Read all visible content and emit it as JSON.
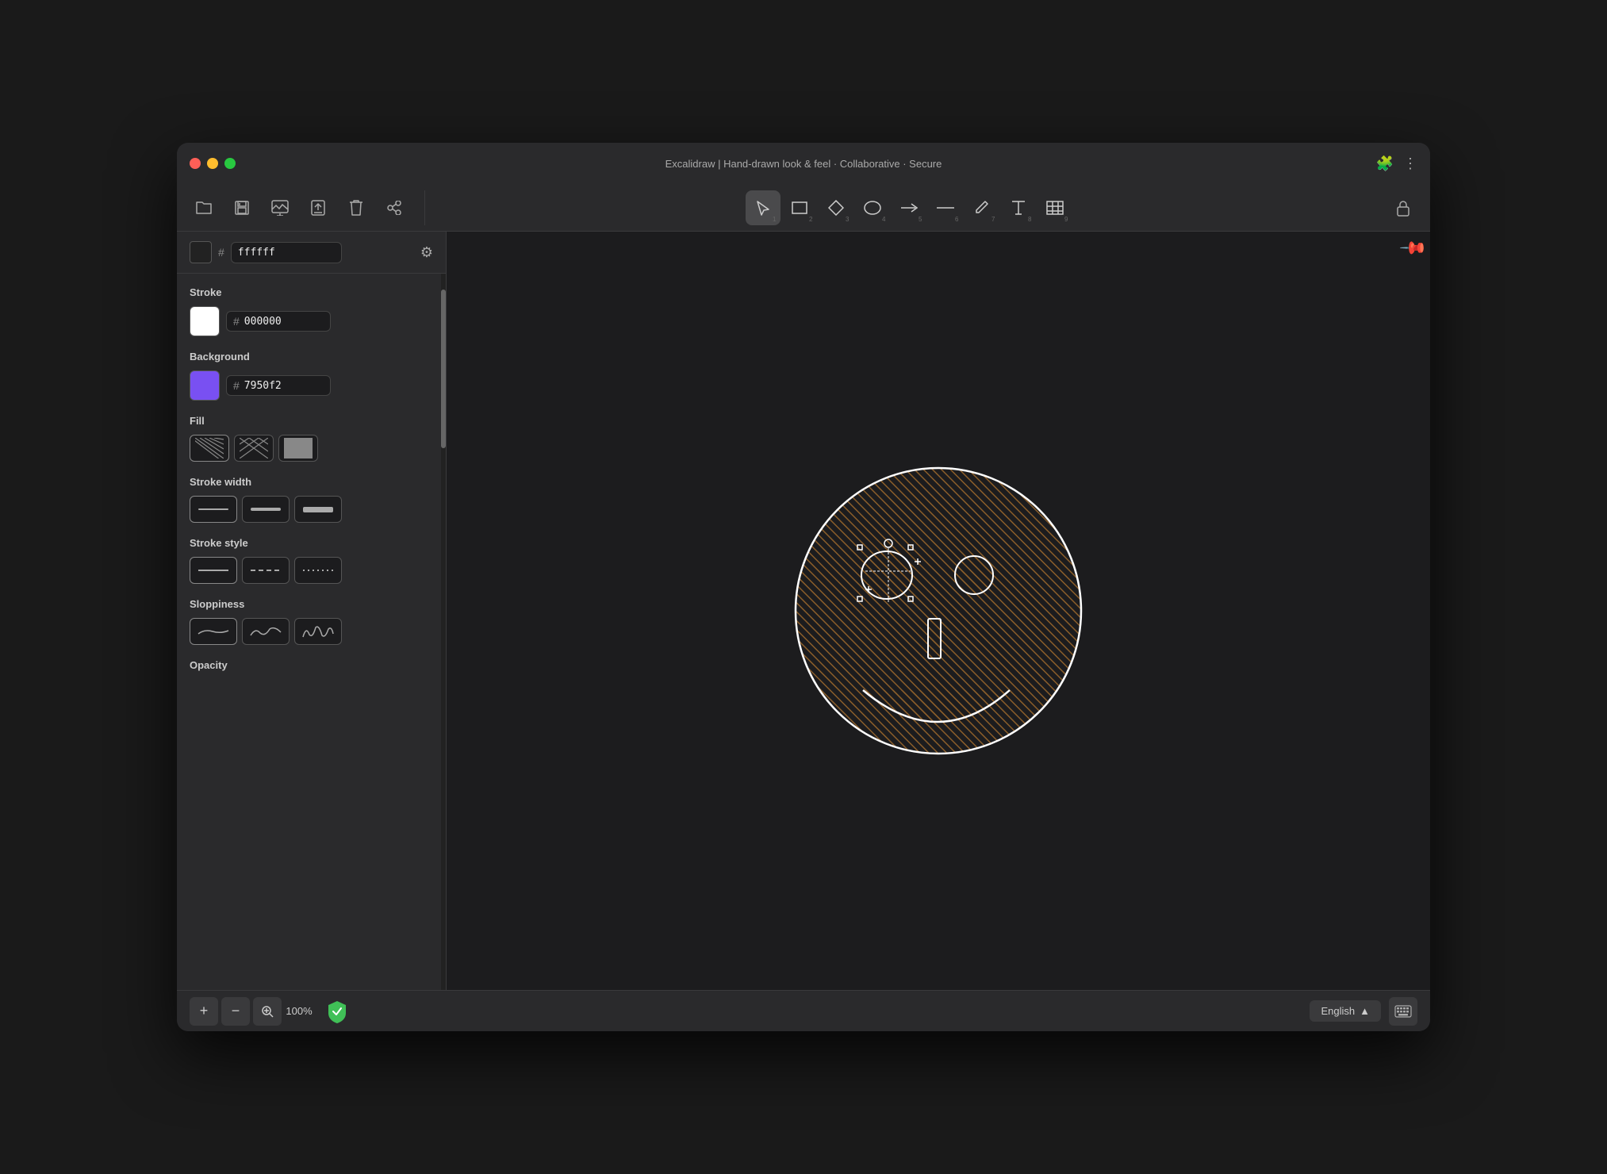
{
  "window": {
    "title": "Excalidraw | Hand-drawn look & feel · Collaborative · Secure"
  },
  "toolbar": {
    "left_tools": [
      {
        "name": "open",
        "icon": "📁",
        "label": "open-icon"
      },
      {
        "name": "save",
        "icon": "💾",
        "label": "save-icon"
      },
      {
        "name": "export-image",
        "icon": "🖼",
        "label": "export-image-icon"
      },
      {
        "name": "export",
        "icon": "📤",
        "label": "export-icon"
      },
      {
        "name": "trash",
        "icon": "🗑",
        "label": "trash-icon"
      },
      {
        "name": "share",
        "icon": "👥",
        "label": "share-icon"
      }
    ],
    "tools": [
      {
        "num": "1",
        "label": "select"
      },
      {
        "num": "2",
        "label": "rectangle"
      },
      {
        "num": "3",
        "label": "diamond"
      },
      {
        "num": "4",
        "label": "ellipse"
      },
      {
        "num": "5",
        "label": "arrow"
      },
      {
        "num": "6",
        "label": "line"
      },
      {
        "num": "7",
        "label": "pencil"
      },
      {
        "num": "8",
        "label": "text"
      },
      {
        "num": "9",
        "label": "image"
      }
    ],
    "lock_icon": "🔓"
  },
  "sidebar": {
    "background_color": "#ffffff",
    "background_hex": "ffffff",
    "stroke": {
      "label": "Stroke",
      "color": "#ffffff",
      "hex": "000000"
    },
    "background": {
      "label": "Background",
      "color": "#7950f2",
      "hex": "7950f2"
    },
    "fill": {
      "label": "Fill",
      "options": [
        "hatch",
        "crosshatch",
        "solid"
      ]
    },
    "stroke_width": {
      "label": "Stroke width",
      "options": [
        "thin",
        "medium",
        "thick"
      ]
    },
    "stroke_style": {
      "label": "Stroke style",
      "options": [
        "solid",
        "dashed",
        "dotted"
      ]
    },
    "sloppiness": {
      "label": "Sloppiness",
      "options": [
        "low",
        "medium",
        "high"
      ]
    },
    "opacity": {
      "label": "Opacity"
    }
  },
  "bottombar": {
    "zoom_in": "+",
    "zoom_out": "−",
    "zoom_level": "100%",
    "language": "English",
    "shield_color": "#40c057"
  }
}
